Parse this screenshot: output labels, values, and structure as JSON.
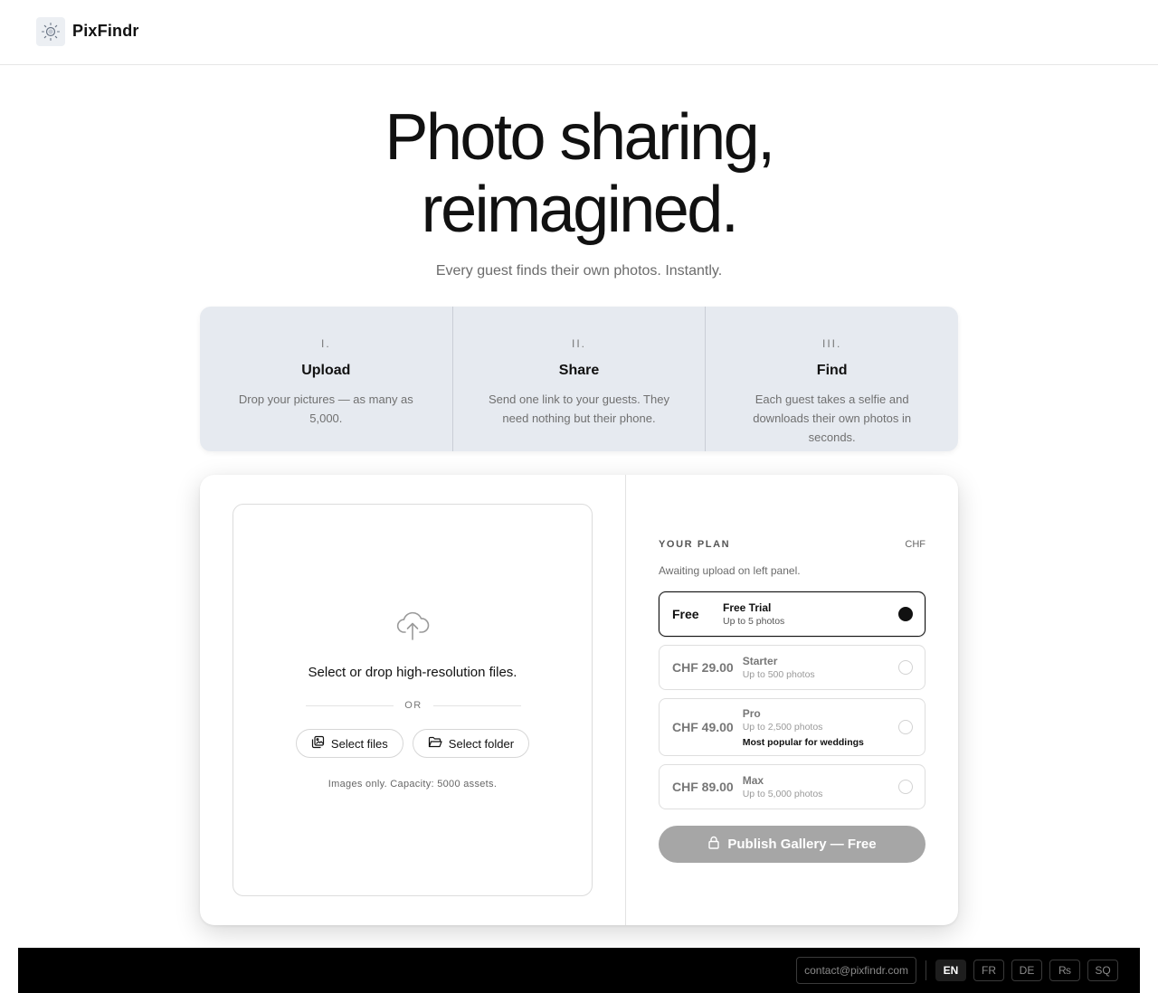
{
  "header": {
    "brand": "PixFindr",
    "logo_icon": "sun-logo-icon"
  },
  "hero": {
    "title_line1": "Photo sharing,",
    "title_line2": "reimagined.",
    "subtitle": "Every guest finds their own photos. Instantly."
  },
  "steps": [
    {
      "num": "I.",
      "title": "Upload",
      "desc": "Drop your pictures — as many as 5,000."
    },
    {
      "num": "II.",
      "title": "Share",
      "desc": "Send one link to your guests. They need nothing but their phone."
    },
    {
      "num": "III.",
      "title": "Find",
      "desc": "Each guest takes a selfie and downloads their own photos in seconds."
    }
  ],
  "upload": {
    "icon": "cloud-upload-icon",
    "drop_text": "Select or drop high-resolution files.",
    "or_text": "OR",
    "select_files": "Select files",
    "select_folder": "Select folder",
    "capacity": "Images only. Capacity: 5000 assets."
  },
  "plan": {
    "label": "YOUR PLAN",
    "currency": "CHF",
    "status": "Awaiting upload on left panel.",
    "options": [
      {
        "price": "Free",
        "name": "Free Trial",
        "limit": "Up to 5 photos",
        "note": "",
        "selected": true
      },
      {
        "price": "CHF 29.00",
        "name": "Starter",
        "limit": "Up to 500 photos",
        "note": "",
        "selected": false
      },
      {
        "price": "CHF 49.00",
        "name": "Pro",
        "limit": "Up to 2,500 photos",
        "note": "Most popular for weddings",
        "selected": false
      },
      {
        "price": "CHF 89.00",
        "name": "Max",
        "limit": "Up to 5,000 photos",
        "note": "",
        "selected": false
      }
    ],
    "publish_label": "Publish Gallery — Free",
    "publish_icon": "lock-icon"
  },
  "footer": {
    "email": "contact@pixfindr.com",
    "languages": [
      "EN",
      "FR",
      "DE",
      "₨",
      "SQ"
    ],
    "active_language": "EN"
  },
  "colors": {
    "steps_bg": "#e6eaf0",
    "publish_disabled": "#a6a6a6",
    "footer_bg": "#000000"
  }
}
